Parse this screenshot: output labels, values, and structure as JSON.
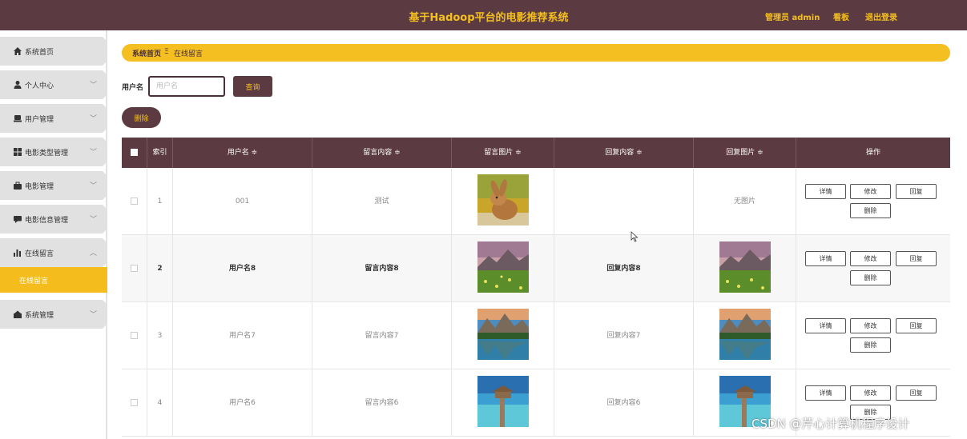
{
  "header": {
    "title": "基于Hadoop平台的电影推荐系统",
    "admin": "管理员 admin",
    "board": "看板",
    "logout": "退出登录"
  },
  "sidebar": {
    "items": [
      {
        "label": "系统首页",
        "icon": "home-icon"
      },
      {
        "label": "个人中心",
        "icon": "user-icon"
      },
      {
        "label": "用户管理",
        "icon": "user-manage-icon"
      },
      {
        "label": "电影类型管理",
        "icon": "grid-icon"
      },
      {
        "label": "电影管理",
        "icon": "briefcase-icon"
      },
      {
        "label": "电影信息管理",
        "icon": "message-icon"
      },
      {
        "label": "在线留言",
        "icon": "bar-chart-icon"
      },
      {
        "label": "系统管理",
        "icon": "settings-icon"
      }
    ],
    "active_sub": "在线留言"
  },
  "breadcrumb": {
    "home": "系统首页",
    "separator": "Ξ",
    "current": "在线留言"
  },
  "search": {
    "label": "用户名",
    "placeholder": "用户名",
    "value": "",
    "button": "查询"
  },
  "actions": {
    "delete": "删除"
  },
  "table": {
    "headers": {
      "index": "索引",
      "username": "用户名 ≑",
      "content": "留言内容 ≑",
      "image": "留言图片 ≑",
      "reply": "回复内容 ≑",
      "reply_image": "回复图片 ≑",
      "ops": "操作"
    },
    "rows": [
      {
        "index": "1",
        "username": "001",
        "content": "测试",
        "reply": "",
        "reply_image_text": "无图片",
        "image": "rabbit",
        "reply_img": "none"
      },
      {
        "index": "2",
        "username": "用户名8",
        "content": "留言内容8",
        "reply": "回复内容8",
        "reply_image_text": "",
        "image": "meadow",
        "reply_img": "meadow"
      },
      {
        "index": "3",
        "username": "用户名7",
        "content": "留言内容7",
        "reply": "回复内容7",
        "reply_image_text": "",
        "image": "lake",
        "reply_img": "lake"
      },
      {
        "index": "4",
        "username": "用户名6",
        "content": "留言内容6",
        "reply": "回复内容6",
        "reply_image_text": "",
        "image": "beach",
        "reply_img": "beach"
      }
    ],
    "op_labels": {
      "detail": "详情",
      "edit": "修改",
      "reply": "回复",
      "delete": "删除"
    }
  },
  "watermark": "CSDN @芹心计算机程序设计",
  "colors": {
    "header_bg": "#5b3a41",
    "accent": "#f4bf20",
    "sidebar_bg": "#e1e1e1"
  }
}
